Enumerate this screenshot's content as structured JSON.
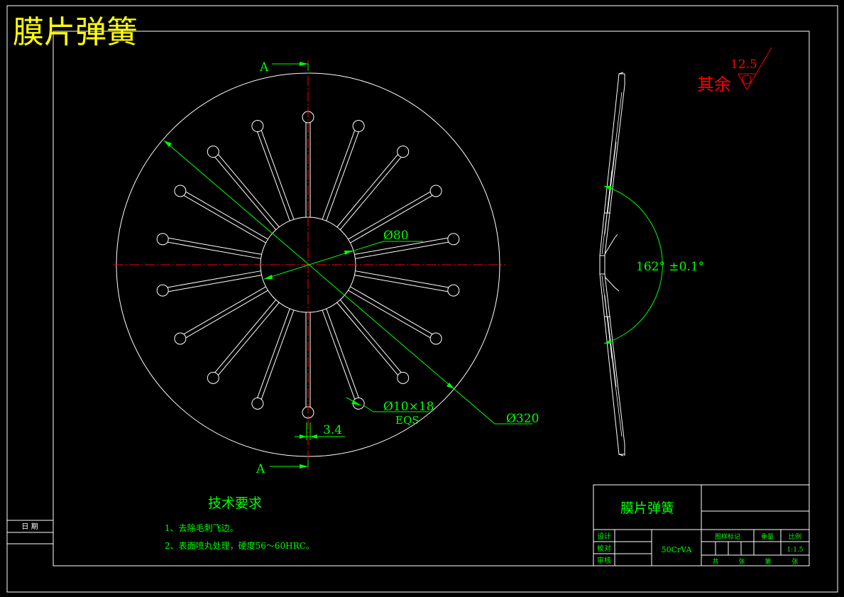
{
  "title": "膜片弹簧",
  "section_marks": {
    "top": "A",
    "bottom": "A"
  },
  "dimensions": {
    "inner_diameter": "Ø80",
    "outer_diameter": "Ø320",
    "holes": "Ø10×18",
    "holes_note": "EQS",
    "slot_width": "3.4",
    "cone_angle": "162° ±0.1°"
  },
  "roughness": {
    "value": "12.5",
    "label": "其余"
  },
  "tech_requirements": {
    "title": "技术要求",
    "items": [
      "1、去除毛刺飞边。",
      "2、表面喷丸处理，硬度56～60HRC。"
    ]
  },
  "title_block": {
    "part_name": "膜片弹簧",
    "material": "50CrVA",
    "rows": [
      "设计",
      "校对",
      "审核"
    ],
    "header_cols": [
      "图样标记",
      "重量",
      "比例"
    ],
    "scale": "1:1.5",
    "footer": [
      "共",
      "张",
      "第",
      "张"
    ]
  },
  "side_label": "日 期",
  "colors": {
    "background": "#000000",
    "lines": "#ffffff",
    "dimension": "#00ff00",
    "centerline": "#ff0000",
    "title": "#ffff00",
    "roughness": "#ff0000"
  },
  "slot_count": 18
}
